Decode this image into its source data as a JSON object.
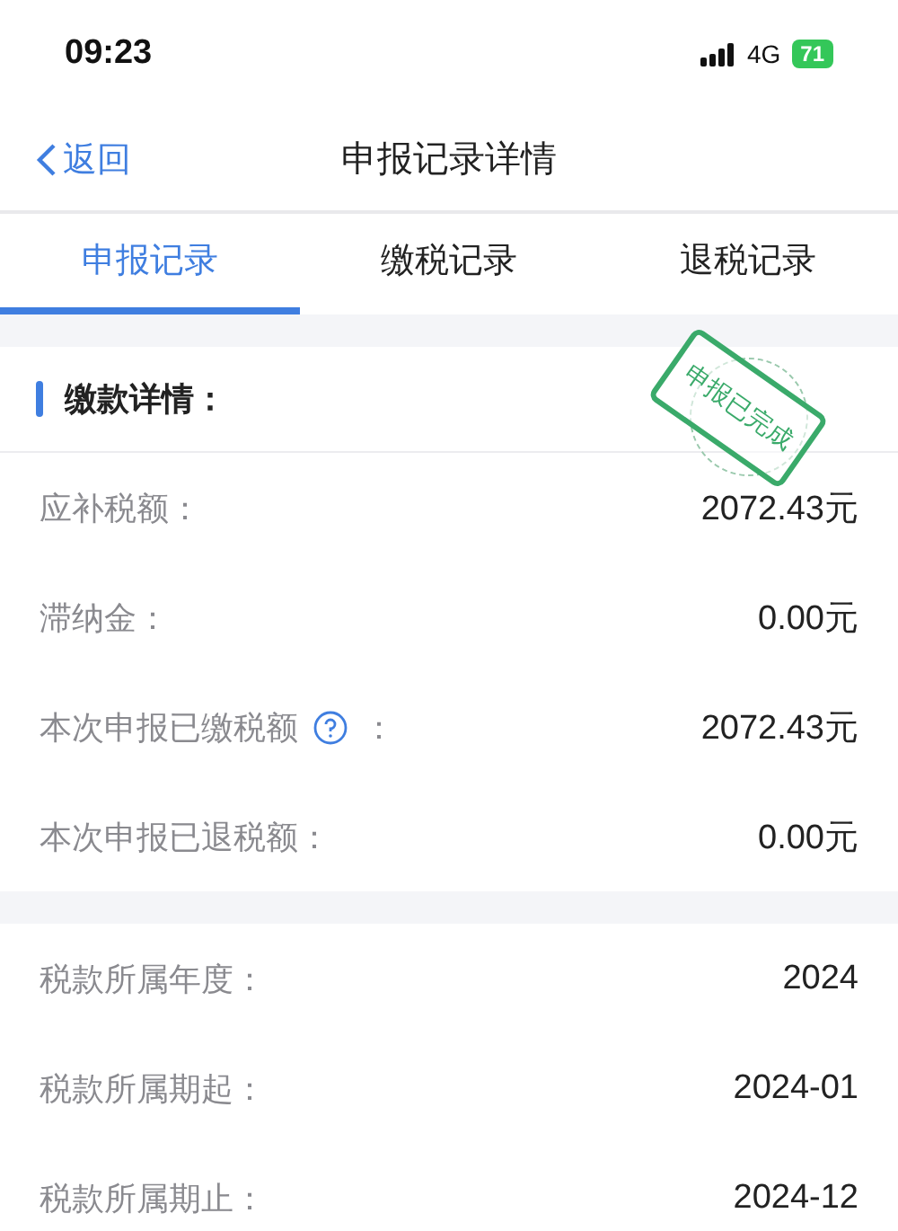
{
  "status_bar": {
    "time": "09:23",
    "network": "4G",
    "battery": "71"
  },
  "nav": {
    "back": "返回",
    "title": "申报记录详情"
  },
  "tabs": [
    {
      "label": "申报记录",
      "selected": true
    },
    {
      "label": "缴税记录",
      "selected": false
    },
    {
      "label": "退税记录",
      "selected": false
    }
  ],
  "payment_section": {
    "title": "缴款详情：",
    "stamp": "申报已完成",
    "rows": [
      {
        "kind": "plain",
        "label": "应补税额：",
        "value": "2072.43元"
      },
      {
        "kind": "plain",
        "label": "滞纳金：",
        "value": "0.00元"
      },
      {
        "kind": "help",
        "label": "本次申报已缴税额",
        "suffix": "：",
        "value": "2072.43元"
      },
      {
        "kind": "plain",
        "label": "本次申报已退税额：",
        "value": "0.00元"
      }
    ]
  },
  "period_section": {
    "rows": [
      {
        "label": "税款所属年度：",
        "value": "2024"
      },
      {
        "label": "税款所属期起：",
        "value": "2024-01"
      },
      {
        "label": "税款所属期止：",
        "value": "2024-12"
      }
    ]
  }
}
